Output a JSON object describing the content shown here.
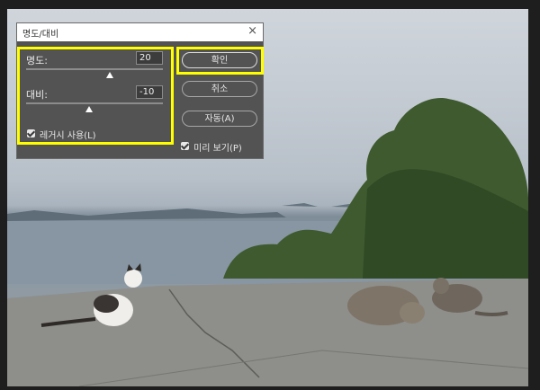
{
  "dialog": {
    "title": "명도/대비",
    "close_icon": "close-icon",
    "brightness": {
      "label": "명도:",
      "value": "20"
    },
    "contrast": {
      "label": "대비:",
      "value": "-10"
    },
    "legacy": {
      "label": "레거시 사용(L)",
      "checked": true
    },
    "buttons": {
      "ok": "확인",
      "cancel": "취소",
      "auto": "자동(A)"
    },
    "preview": {
      "label": "미리 보기(P)",
      "checked": true
    }
  },
  "colors": {
    "highlight": "#ffff00",
    "dialog_bg": "#535353",
    "workspace_bg": "#1e1e1e"
  }
}
